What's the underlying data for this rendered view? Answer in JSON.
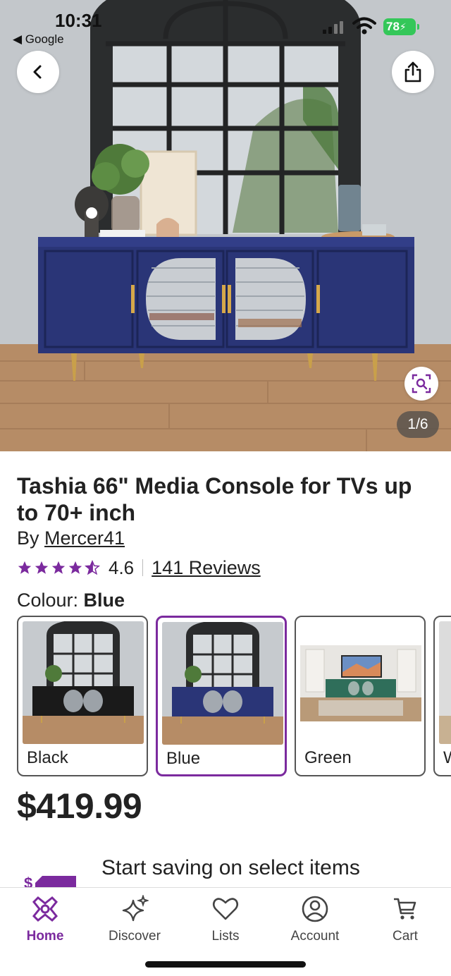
{
  "status_bar": {
    "time": "10:31",
    "back_app": "◀ Google",
    "battery": "78"
  },
  "hero": {
    "image_counter": "1/6",
    "icons": [
      "back-icon",
      "share-icon",
      "visual-search-icon"
    ]
  },
  "product": {
    "title": "Tashia 66\" Media Console for TVs up to 70+ inch",
    "by_prefix": "By ",
    "brand": "Mercer41",
    "rating": 4.6,
    "rating_text": "4.6",
    "reviews": "141 Reviews",
    "colour_label": "Colour: ",
    "colour_selected": "Blue",
    "swatches": [
      {
        "label": "Black",
        "selected": false
      },
      {
        "label": "Blue",
        "selected": true
      },
      {
        "label": "Green",
        "selected": false
      },
      {
        "label": "W",
        "selected": false
      }
    ],
    "price": "$419.99"
  },
  "promo": {
    "text": "Start saving on select items"
  },
  "bottom_nav": {
    "items": [
      {
        "label": "Home",
        "icon": "home-icon",
        "active": true
      },
      {
        "label": "Discover",
        "icon": "sparkle-icon",
        "active": false
      },
      {
        "label": "Lists",
        "icon": "heart-icon",
        "active": false
      },
      {
        "label": "Account",
        "icon": "account-icon",
        "active": false
      },
      {
        "label": "Cart",
        "icon": "cart-icon",
        "active": false
      }
    ]
  },
  "colors": {
    "accent": "#7b2a9e",
    "console_blue": "#2a3577",
    "battery": "#34c759"
  }
}
